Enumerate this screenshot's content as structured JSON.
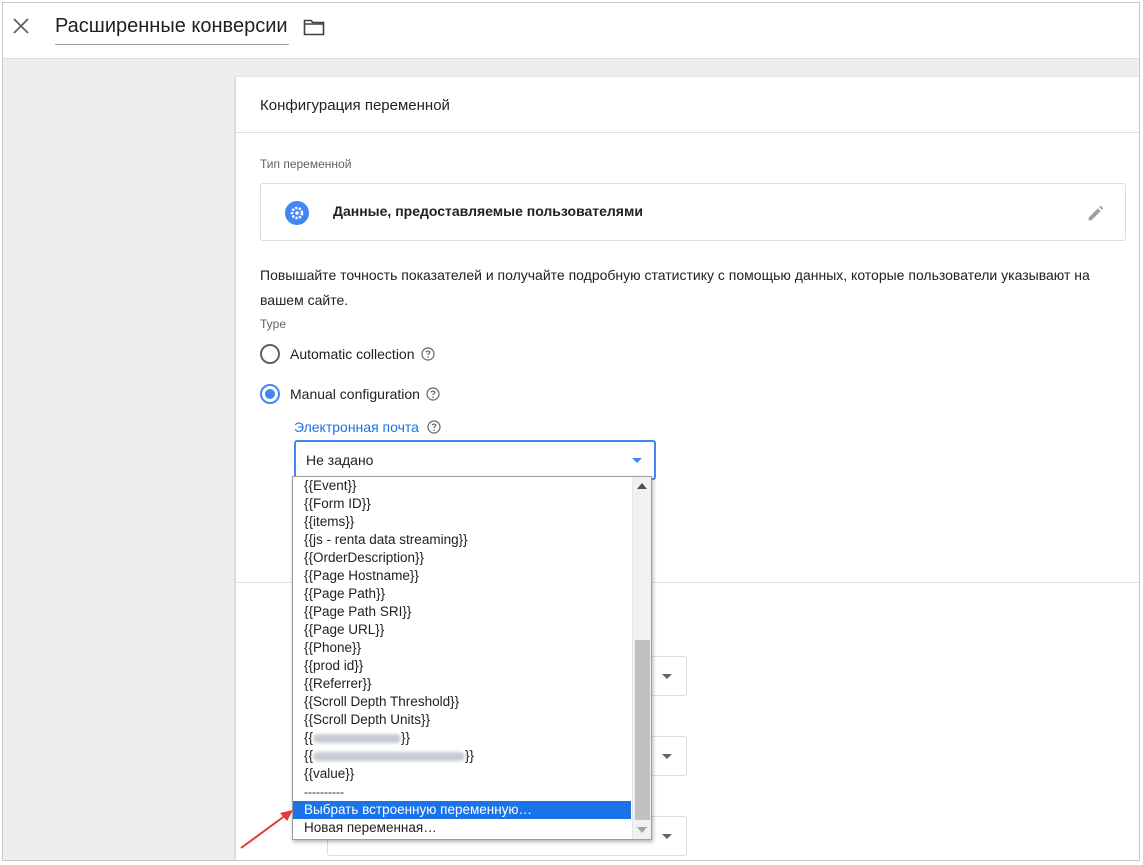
{
  "header": {
    "title": "Расширенные конверсии",
    "close_icon": "close-icon",
    "folder_icon": "folder-icon"
  },
  "card": {
    "heading": "Конфигурация переменной",
    "variable_type_label": "Тип переменной",
    "variable_type_name": "Данные, предоставляемые пользователями",
    "variable_type_icon": "gear-icon",
    "edit_icon": "pencil-icon",
    "description": "Повышайте точность показателей и получайте подробную статистику с помощью данных, которые пользователи указывают на вашем сайте.",
    "type_label": "Type",
    "options": [
      {
        "label": "Automatic collection",
        "checked": false
      },
      {
        "label": "Manual configuration",
        "checked": true
      }
    ],
    "email_label": "Электронная почта",
    "email_value": "Не задано"
  },
  "dropdown": {
    "items": [
      "{{Event}}",
      "{{Form ID}}",
      "{{items}}",
      "{{js - renta data streaming}}",
      "{{OrderDescription}}",
      "{{Page Hostname}}",
      "{{Page Path}}",
      "{{Page Path SRI}}",
      "{{Page URL}}",
      "{{Phone}}",
      "{{prod id}}",
      "{{Referrer}}",
      "{{Scroll Depth Threshold}}",
      "{{Scroll Depth Units}}"
    ],
    "redacted_open": "{{",
    "redacted_close": "}}",
    "value_item": "{{value}}",
    "separator": "----------",
    "selected_item": "Выбрать встроенную переменную…",
    "new_item": "Новая переменная…"
  },
  "colors": {
    "accent": "#1a73e8",
    "radio_checked": "#4285f4",
    "annotation_arrow": "#e53935"
  }
}
